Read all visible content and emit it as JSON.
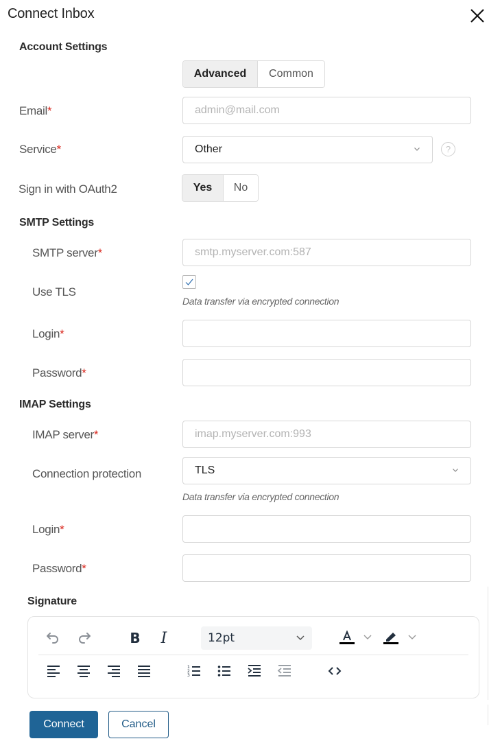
{
  "dialog": {
    "title": "Connect Inbox",
    "close_icon": "close-icon"
  },
  "account": {
    "heading": "Account Settings",
    "mode_options": [
      {
        "label": "Advanced",
        "selected": true
      },
      {
        "label": "Common",
        "selected": false
      }
    ],
    "email": {
      "label": "Email",
      "required": "*",
      "value": "",
      "placeholder": "admin@mail.com"
    },
    "service": {
      "label": "Service",
      "required": "*",
      "value": "Other",
      "help_icon": "question-circle-icon",
      "help_glyph": "?"
    },
    "oauth": {
      "label": "Sign in with OAuth2",
      "options": [
        {
          "label": "Yes",
          "selected": true
        },
        {
          "label": "No",
          "selected": false
        }
      ]
    }
  },
  "smtp": {
    "heading": "SMTP Settings",
    "server": {
      "label": "SMTP server",
      "required": "*",
      "value": "",
      "placeholder": "smtp.myserver.com:587"
    },
    "use_tls": {
      "label": "Use TLS",
      "checked": true,
      "hint": "Data transfer via encrypted connection"
    },
    "login": {
      "label": "Login",
      "required": "*",
      "value": ""
    },
    "password": {
      "label": "Password",
      "required": "*",
      "value": ""
    }
  },
  "imap": {
    "heading": "IMAP Settings",
    "server": {
      "label": "IMAP server",
      "required": "*",
      "value": "",
      "placeholder": "imap.myserver.com:993"
    },
    "protection": {
      "label": "Connection protection",
      "value": "TLS",
      "hint": "Data transfer via encrypted connection"
    },
    "login": {
      "label": "Login",
      "required": "*",
      "value": ""
    },
    "password": {
      "label": "Password",
      "required": "*",
      "value": ""
    }
  },
  "signature": {
    "heading": "Signature",
    "toolbar": {
      "font_size": "12pt",
      "icons": [
        "undo-icon",
        "redo-icon",
        "bold-icon",
        "italic-icon",
        "font-size-select",
        "text-color-icon",
        "highlight-color-icon",
        "align-left-icon",
        "align-center-icon",
        "align-right-icon",
        "align-justify-icon",
        "numbered-list-icon",
        "bullet-list-icon",
        "indent-icon",
        "outdent-icon",
        "source-code-icon"
      ],
      "bold_glyph": "B",
      "italic_glyph": "I",
      "text_color": "#000000",
      "highlight_color": "#000000"
    },
    "content": ""
  },
  "actions": {
    "connect_label": "Connect",
    "cancel_label": "Cancel",
    "primary_color": "#1f6496"
  }
}
